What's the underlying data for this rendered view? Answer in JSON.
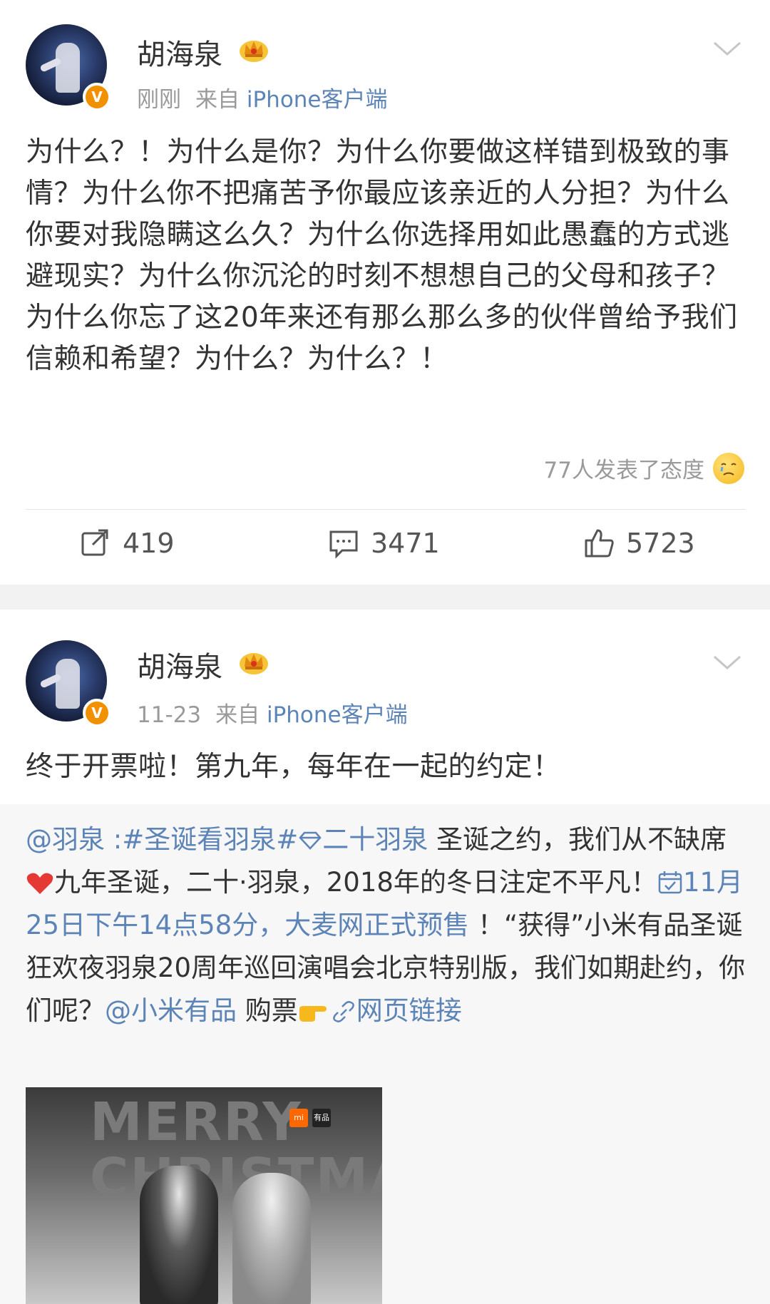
{
  "posts": [
    {
      "username": "胡海泉",
      "time": "刚刚",
      "from_label": "来自",
      "source": "iPhone客户端",
      "content": "为什么？！为什么是你？为什么你要做这样错到极致的事情？为什么你不把痛苦予你最应该亲近的人分担？为什么你要对我隐瞒这么久？为什么你选择用如此愚蠢的方式逃避现实？为什么你沉沦的时刻不想想自己的父母和孩子？为什么你忘了这20年来还有那么那么多的伙伴曾给予我们信赖和希望？为什么？为什么？！",
      "reactions_text": "77人发表了态度",
      "reposts": "419",
      "comments": "3471",
      "likes": "5723"
    },
    {
      "username": "胡海泉",
      "time": "11-23",
      "from_label": "来自",
      "source": "iPhone客户端",
      "content": "终于开票啦！第九年，每年在一起的约定！",
      "retweet": {
        "mention": "@羽泉",
        "sep": " :",
        "topic": "#圣诞看羽泉#",
        "topic2": "二十羽泉",
        "text1": " 圣诞之约，我们从不缺席",
        "text2": "九年圣诞，二十·羽泉，2018年的冬日注定不平凡！",
        "date_link": "11月25日下午14点58分，大麦网正式预售",
        "text3": " ！“获得”小米有品圣诞狂欢夜羽泉20周年巡回演唱会北京特别版，我们如期赴约，你们呢？",
        "mention2": "@小米有品",
        "text4": " 购票",
        "web_link": "网页链接",
        "image_banner": "MERRY CHRISTMAS",
        "logo_mi": "mi",
        "logo_youpin": "有品"
      }
    }
  ],
  "colors": {
    "link": "#5c84b7",
    "verified_badge": "#f29100",
    "meta_gray": "#9a9a9a"
  },
  "icons": [
    "chevron-down-icon",
    "crown-icon",
    "repost-icon",
    "comment-icon",
    "like-icon",
    "emoji-icon",
    "heart-icon",
    "calendar-icon",
    "link-icon",
    "diamond-icon",
    "pointing-hand-icon"
  ]
}
